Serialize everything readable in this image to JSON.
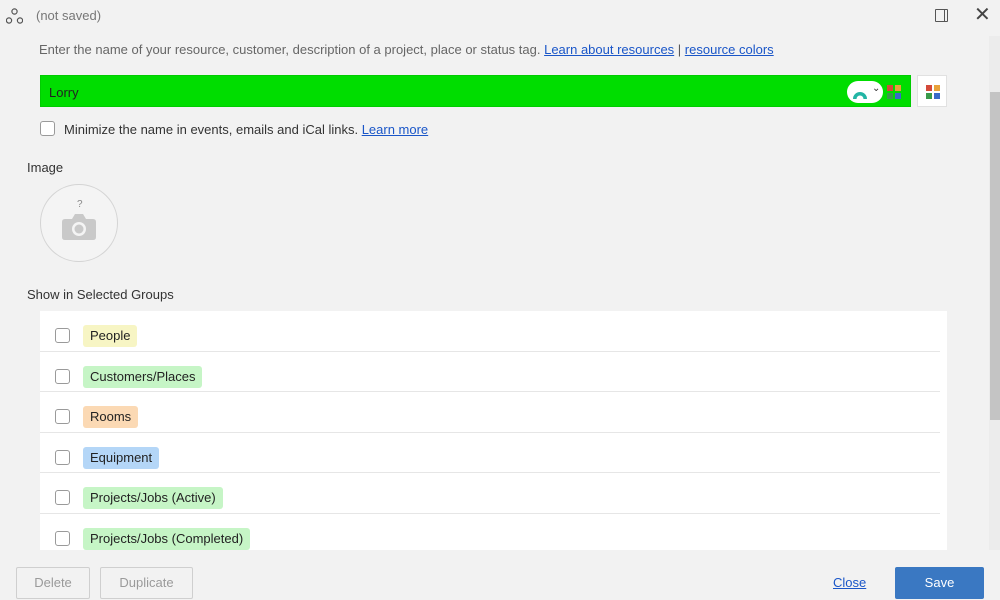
{
  "header": {
    "title": "(not saved)",
    "close_glyph": "✕"
  },
  "hint": {
    "text": "Enter the name of your resource, customer, description of a project, place or status tag. ",
    "link_resources": "Learn about resources",
    "separator": " | ",
    "link_colors": "resource colors"
  },
  "name_field": {
    "value": "Lorry",
    "color": "#00dd00"
  },
  "minimize": {
    "label": "Minimize the name in events, emails and iCal links. ",
    "link": "Learn more",
    "checked": false
  },
  "image": {
    "label": "Image",
    "placeholder_glyph": "?"
  },
  "groups": {
    "label": "Show in Selected Groups",
    "items": [
      {
        "label": "People",
        "color": "#f7f5c4",
        "checked": false
      },
      {
        "label": "Customers/Places",
        "color": "#c6f5c6",
        "checked": false
      },
      {
        "label": "Rooms",
        "color": "#fbd9b4",
        "checked": false
      },
      {
        "label": "Equipment",
        "color": "#b4d6f7",
        "checked": false
      },
      {
        "label": "Projects/Jobs (Active)",
        "color": "#c6f5c6",
        "checked": false
      },
      {
        "label": "Projects/Jobs (Completed)",
        "color": "#c6f5c6",
        "checked": false
      }
    ]
  },
  "footer": {
    "delete_label": "Delete",
    "duplicate_label": "Duplicate",
    "close_label": "Close",
    "save_label": "Save"
  },
  "colors": {
    "accent": "#3a78c2",
    "link": "#1a56c8"
  }
}
